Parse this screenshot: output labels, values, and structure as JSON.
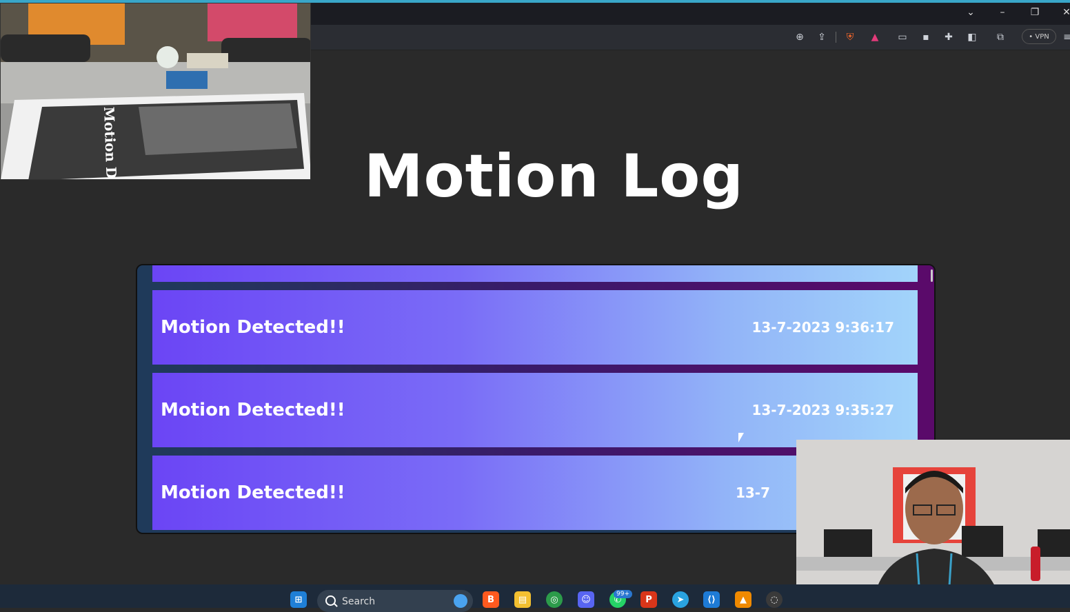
{
  "page": {
    "title": "Motion Log"
  },
  "log": {
    "entries": [
      {
        "message": "Motion Detected!!",
        "timestamp": "13-7-2023 9:36:17"
      },
      {
        "message": "Motion Detected!!",
        "timestamp": "13-7-2023 9:35:27"
      },
      {
        "message": "Motion Detected!!",
        "timestamp": "13-7"
      }
    ]
  },
  "browser": {
    "vpn_label": "• VPN",
    "icons": [
      "zoom-icon",
      "share-icon",
      "brave-shield-icon",
      "brave-rewards-icon",
      "tab-icon",
      "wallet-icon",
      "extensions-icon",
      "sidebar-icon",
      "profile-icon",
      "menu-icon"
    ]
  },
  "taskbar": {
    "search_placeholder": "Search",
    "whatsapp_badge": "99+"
  },
  "webcam_top": {
    "document_text": "Motion Detection Tracking System"
  }
}
